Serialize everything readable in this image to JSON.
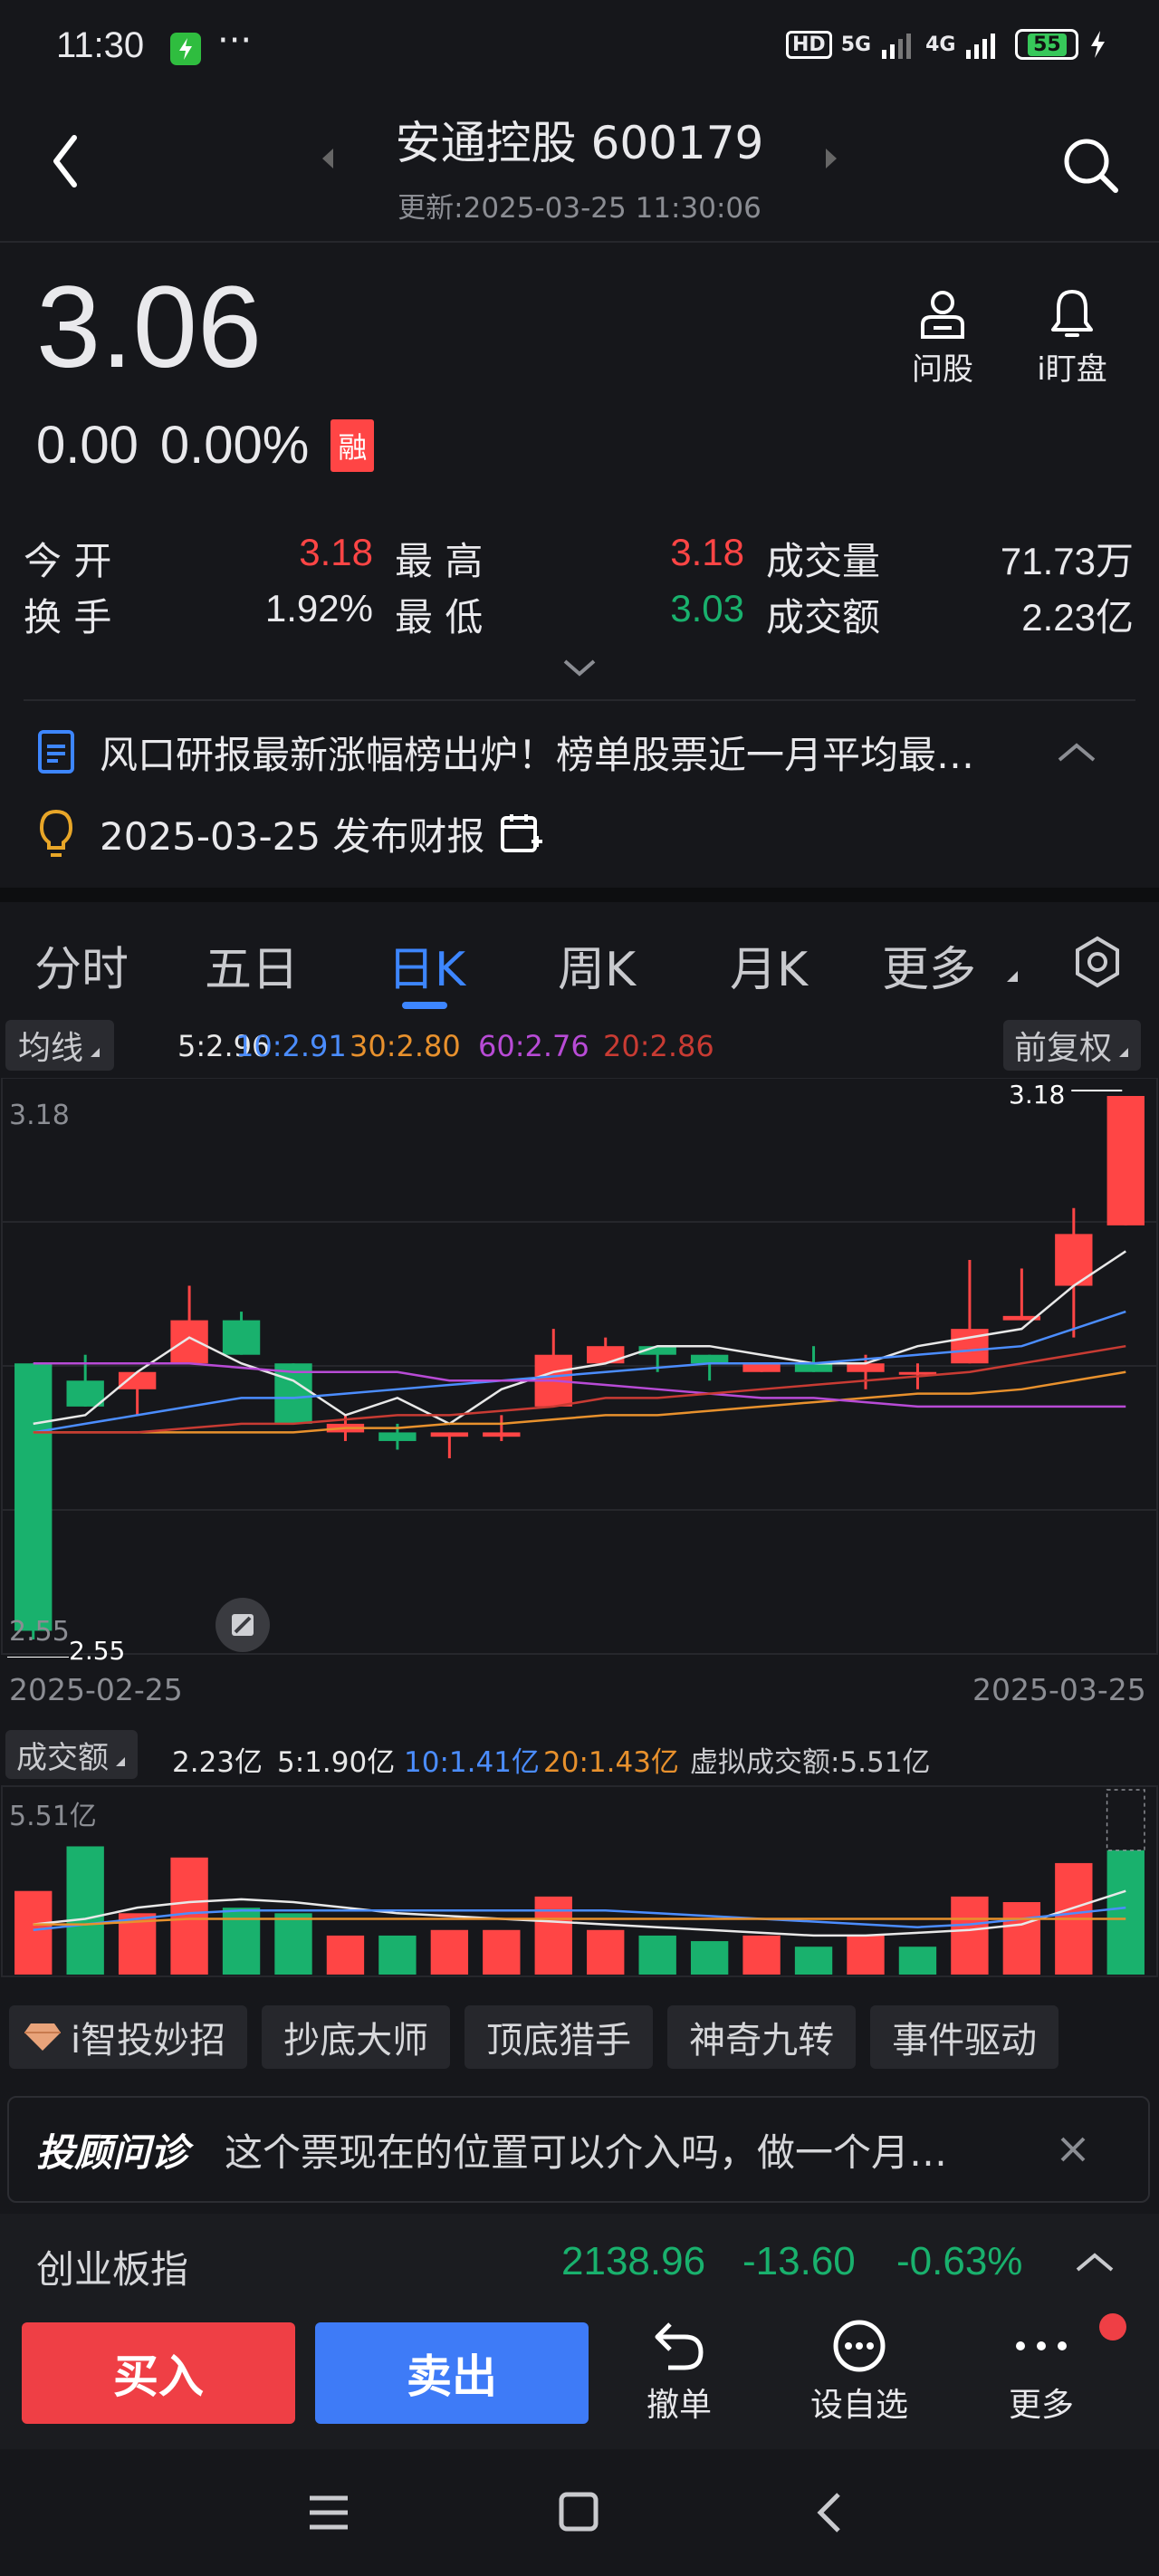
{
  "status_bar": {
    "time": "11:30",
    "dots": "···",
    "hd": "HD",
    "net5g": "5G",
    "net4g": "4G",
    "battery": "55"
  },
  "header": {
    "title": "安通控股 600179",
    "updated": "更新:2025-03-25 11:30:06"
  },
  "quote": {
    "price": "3.06",
    "change": "0.00",
    "change_pct": "0.00%",
    "rong_badge": "融",
    "ask_label": "问股",
    "watch_label": "i盯盘"
  },
  "stats": {
    "open_label": "今 开",
    "open": "3.18",
    "high_label": "最 高",
    "high": "3.18",
    "vol_label": "成交量",
    "vol": "71.73万",
    "turnover_label": "换 手",
    "turnover": "1.92%",
    "low_label": "最 低",
    "low": "3.03",
    "amount_label": "成交额",
    "amount": "2.23亿"
  },
  "news": {
    "headline": "风口研报最新涨幅榜出炉！榜单股票近一月平均最…",
    "event": "2025-03-25 发布财报"
  },
  "chart_tabs": [
    "分时",
    "五日",
    "日K",
    "周K",
    "月K",
    "更多"
  ],
  "active_tab": "日K",
  "ma_bar": {
    "label": "均线",
    "ma5": "5:2.96",
    "ma10": "10:2.91",
    "ma30": "30:2.80",
    "ma60": "60:2.76",
    "ma20": "20:2.86",
    "adjust": "前复权"
  },
  "vol_bar": {
    "label": "成交额",
    "total": "2.23亿",
    "ma5": "5:1.90亿",
    "ma10": "10:1.41亿",
    "ma20": "20:1.43亿",
    "virtual": "虚拟成交额:5.51亿"
  },
  "colors": {
    "up": "#ff4545",
    "down": "#19b16d",
    "ma5": "#e8e8e8",
    "ma10": "#4b8dff",
    "ma30": "#e8912d",
    "ma60": "#b84bd6",
    "ma20": "#c83b33",
    "accent": "#3d86ff"
  },
  "chart_data": {
    "type": "candlestick",
    "x_start": "2025-02-25",
    "x_end": "2025-03-25",
    "high_label": "3.18",
    "low_label": "2.55",
    "y_top_label": "3.18",
    "y_bottom_label": "2.55",
    "candles": [
      {
        "o": 2.87,
        "c": 2.56,
        "h": 2.87,
        "l": 2.55
      },
      {
        "o": 2.85,
        "c": 2.82,
        "h": 2.88,
        "l": 2.82
      },
      {
        "o": 2.84,
        "c": 2.86,
        "h": 2.86,
        "l": 2.81
      },
      {
        "o": 2.87,
        "c": 2.92,
        "h": 2.96,
        "l": 2.87
      },
      {
        "o": 2.92,
        "c": 2.88,
        "h": 2.93,
        "l": 2.88
      },
      {
        "o": 2.87,
        "c": 2.8,
        "h": 2.87,
        "l": 2.8
      },
      {
        "o": 2.79,
        "c": 2.8,
        "h": 2.81,
        "l": 2.78
      },
      {
        "o": 2.79,
        "c": 2.78,
        "h": 2.8,
        "l": 2.77
      },
      {
        "o": 2.785,
        "c": 2.79,
        "h": 2.79,
        "l": 2.76
      },
      {
        "o": 2.785,
        "c": 2.79,
        "h": 2.81,
        "l": 2.78
      },
      {
        "o": 2.82,
        "c": 2.88,
        "h": 2.91,
        "l": 2.82
      },
      {
        "o": 2.87,
        "c": 2.89,
        "h": 2.9,
        "l": 2.87
      },
      {
        "o": 2.89,
        "c": 2.88,
        "h": 2.89,
        "l": 2.86
      },
      {
        "o": 2.88,
        "c": 2.87,
        "h": 2.88,
        "l": 2.85
      },
      {
        "o": 2.86,
        "c": 2.87,
        "h": 2.87,
        "l": 2.86
      },
      {
        "o": 2.87,
        "c": 2.86,
        "h": 2.89,
        "l": 2.86
      },
      {
        "o": 2.86,
        "c": 2.87,
        "h": 2.88,
        "l": 2.84
      },
      {
        "o": 2.86,
        "c": 2.86,
        "h": 2.87,
        "l": 2.84
      },
      {
        "o": 2.87,
        "c": 2.91,
        "h": 2.99,
        "l": 2.87
      },
      {
        "o": 2.92,
        "c": 2.925,
        "h": 2.98,
        "l": 2.92
      },
      {
        "o": 2.96,
        "c": 3.02,
        "h": 3.05,
        "l": 2.9
      },
      {
        "o": 3.03,
        "c": 3.18,
        "h": 3.18,
        "l": 3.03
      }
    ],
    "ma5": [
      2.8,
      2.81,
      2.86,
      2.9,
      2.87,
      2.85,
      2.81,
      2.83,
      2.8,
      2.84,
      2.86,
      2.87,
      2.89,
      2.89,
      2.88,
      2.87,
      2.87,
      2.89,
      2.9,
      2.91,
      2.96,
      3.0
    ],
    "ma10": [
      2.79,
      2.8,
      2.81,
      2.82,
      2.83,
      2.83,
      2.835,
      2.84,
      2.845,
      2.85,
      2.855,
      2.86,
      2.865,
      2.87,
      2.87,
      2.87,
      2.875,
      2.88,
      2.885,
      2.89,
      2.91,
      2.93
    ],
    "ma20": [
      2.79,
      2.79,
      2.79,
      2.795,
      2.8,
      2.8,
      2.805,
      2.81,
      2.81,
      2.815,
      2.82,
      2.83,
      2.83,
      2.835,
      2.84,
      2.845,
      2.85,
      2.855,
      2.86,
      2.87,
      2.88,
      2.89
    ],
    "ma30": [
      2.79,
      2.79,
      2.79,
      2.79,
      2.79,
      2.79,
      2.795,
      2.795,
      2.8,
      2.8,
      2.805,
      2.81,
      2.81,
      2.815,
      2.82,
      2.825,
      2.83,
      2.835,
      2.835,
      2.84,
      2.85,
      2.86
    ],
    "ma60": [
      2.87,
      2.87,
      2.87,
      2.87,
      2.865,
      2.86,
      2.86,
      2.86,
      2.85,
      2.85,
      2.85,
      2.845,
      2.84,
      2.835,
      2.83,
      2.83,
      2.825,
      2.82,
      2.82,
      2.82,
      2.82,
      2.82
    ],
    "volume_max_label": "5.51亿",
    "volumes": [
      1.5,
      2.3,
      1.1,
      2.1,
      1.2,
      1.1,
      0.7,
      0.7,
      0.8,
      0.8,
      1.4,
      0.8,
      0.7,
      0.6,
      0.7,
      0.5,
      0.7,
      0.5,
      1.4,
      1.3,
      2.0,
      2.23
    ],
    "volume_up": [
      true,
      false,
      true,
      true,
      false,
      false,
      true,
      false,
      true,
      true,
      true,
      true,
      false,
      false,
      true,
      false,
      true,
      false,
      true,
      true,
      true,
      false
    ],
    "vol_ma5": [
      0.9,
      1.0,
      1.2,
      1.3,
      1.35,
      1.3,
      1.2,
      1.1,
      1.05,
      1.0,
      0.95,
      0.9,
      0.85,
      0.8,
      0.75,
      0.7,
      0.7,
      0.75,
      0.8,
      0.9,
      1.2,
      1.5
    ],
    "vol_ma10": [
      0.8,
      0.9,
      1.0,
      1.1,
      1.15,
      1.15,
      1.15,
      1.15,
      1.15,
      1.15,
      1.15,
      1.15,
      1.1,
      1.05,
      1.0,
      0.95,
      0.9,
      0.85,
      0.9,
      1.0,
      1.1,
      1.2
    ],
    "vol_ma20": [
      0.9,
      0.9,
      0.95,
      1.0,
      1.0,
      1.0,
      1.0,
      1.0,
      1.0,
      1.0,
      1.0,
      1.0,
      1.0,
      1.0,
      1.0,
      1.0,
      1.0,
      1.0,
      1.0,
      1.0,
      1.0,
      1.0
    ],
    "y_min": 2.55,
    "y_max": 3.18
  },
  "tools": [
    "i智投妙招",
    "抄底大师",
    "顶底猎手",
    "神奇九转",
    "事件驱动"
  ],
  "advisor": {
    "logo": "投顾问诊",
    "text": "这个票现在的位置可以介入吗，做一个月…"
  },
  "index": {
    "name": "创业板指",
    "value": "2138.96",
    "change": "-13.60",
    "pct": "-0.63%"
  },
  "bottom": {
    "buy": "买入",
    "sell": "卖出",
    "cancel": "撤单",
    "watchlist": "设自选",
    "more": "更多"
  }
}
